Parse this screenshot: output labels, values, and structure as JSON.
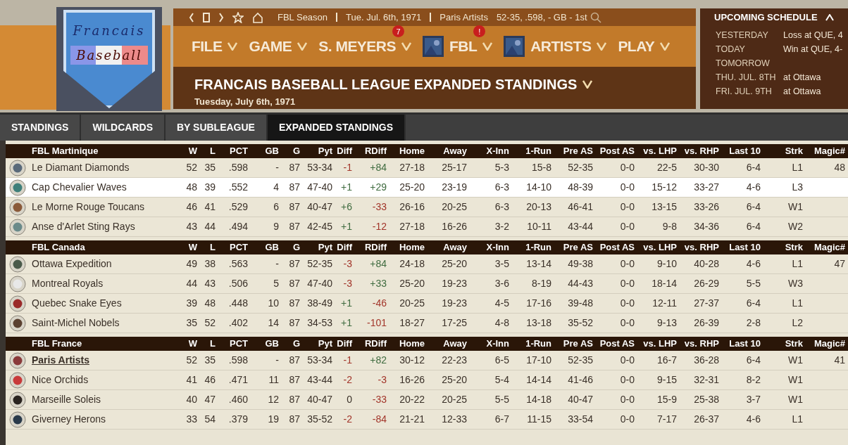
{
  "logo": {
    "top": "Francais",
    "bottom": "Baseball"
  },
  "info_bar": {
    "season": "FBL Season",
    "date": "Tue. Jul. 6th, 1971",
    "team": "Paris Artists",
    "record": "52-35, .598, - GB - 1st"
  },
  "menu": [
    {
      "label": "FILE"
    },
    {
      "label": "GAME"
    },
    {
      "label": "S. MEYERS",
      "badge": "7"
    },
    {
      "label": "FBL",
      "badge": "!",
      "thumbnail": true
    },
    {
      "label": "ARTISTS",
      "thumbnail": true
    },
    {
      "label": "PLAY"
    }
  ],
  "page_title": "FRANCAIS BASEBALL LEAGUE EXPANDED STANDINGS",
  "page_subtitle": "Tuesday, July 6th, 1971",
  "schedule": {
    "title": "UPCOMING SCHEDULE",
    "items": [
      {
        "day": "YESTERDAY",
        "result": "Loss at QUE, 4"
      },
      {
        "day": "TODAY",
        "result": "Win at QUE, 4-"
      },
      {
        "day": "TOMORROW"
      },
      {
        "day": "THU. JUL. 8TH",
        "result": "at Ottawa"
      },
      {
        "day": "FRI. JUL. 9TH",
        "result": "at Ottawa"
      }
    ]
  },
  "tabs": [
    {
      "label": "STANDINGS",
      "selected": false
    },
    {
      "label": "WILDCARDS",
      "selected": false
    },
    {
      "label": "BY SUBLEAGUE",
      "selected": false
    },
    {
      "label": "EXPANDED STANDINGS",
      "selected": true
    }
  ],
  "groups": [
    {
      "name": "FBL Martinique",
      "columns": [
        "W",
        "L",
        "PCT",
        "GB",
        "G",
        "Pyt",
        "Diff",
        "RDiff",
        "Home",
        "Away",
        "X-Inn",
        "1-Run",
        "Pre AS",
        "Post AS",
        "vs. LHP",
        "vs. RHP",
        "Last 10",
        "Strk",
        "Magic#"
      ],
      "rows": [
        {
          "team": "Le Diamant Diamonds",
          "selected": false,
          "own_team": false,
          "stats": [
            "52",
            "35",
            ".598",
            "-",
            "87",
            "53-34"
          ],
          "diff": {
            "text": "-1",
            "color": "#a2352a"
          },
          "rdiff": {
            "text": "+84",
            "color": "#3f6b3f"
          },
          "stats_2": [
            "27-18",
            "25-17",
            "5-3",
            "15-8",
            "52-35",
            "0-0",
            "22-5",
            "30-30",
            "6-4",
            "L1"
          ],
          "magic": "48"
        },
        {
          "team": "Cap Chevalier Waves",
          "selected": true,
          "own_team": false,
          "stats": [
            "48",
            "39",
            ".552",
            "4",
            "87",
            "47-40"
          ],
          "diff": {
            "text": "+1",
            "color": "#3f6b3f"
          },
          "rdiff": {
            "text": "+29",
            "color": "#3f6b3f"
          },
          "stats_2": [
            "25-20",
            "23-19",
            "6-3",
            "14-10",
            "48-39",
            "0-0",
            "15-12",
            "33-27",
            "4-6",
            "L3"
          ]
        },
        {
          "team": "Le Morne Rouge Toucans",
          "selected": false,
          "own_team": false,
          "stats": [
            "46",
            "41",
            ".529",
            "6",
            "87",
            "40-47"
          ],
          "diff": {
            "text": "+6",
            "color": "#3f6b3f"
          },
          "rdiff": {
            "text": "-33",
            "color": "#a2352a"
          },
          "stats_2": [
            "26-16",
            "20-25",
            "6-3",
            "20-13",
            "46-41",
            "0-0",
            "13-15",
            "33-26",
            "6-4",
            "W1"
          ]
        },
        {
          "team": "Anse d'Arlet Sting Rays",
          "selected": false,
          "own_team": false,
          "stats": [
            "43",
            "44",
            ".494",
            "9",
            "87",
            "42-45"
          ],
          "diff": {
            "text": "+1",
            "color": "#3f6b3f"
          },
          "rdiff": {
            "text": "-12",
            "color": "#a2352a"
          },
          "stats_2": [
            "27-18",
            "16-26",
            "3-2",
            "10-11",
            "43-44",
            "0-0",
            "9-8",
            "34-36",
            "6-4",
            "W2"
          ]
        }
      ]
    },
    {
      "name": "FBL Canada",
      "columns": [
        "W",
        "L",
        "PCT",
        "GB",
        "G",
        "Pyt",
        "Diff",
        "RDiff",
        "Home",
        "Away",
        "X-Inn",
        "1-Run",
        "Pre AS",
        "Post AS",
        "vs. LHP",
        "vs. RHP",
        "Last 10",
        "Strk",
        "Magic#"
      ],
      "rows": [
        {
          "team": "Ottawa Expedition",
          "selected": false,
          "own_team": false,
          "stats": [
            "49",
            "38",
            ".563",
            "-",
            "87",
            "52-35"
          ],
          "diff": {
            "text": "-3",
            "color": "#a2352a"
          },
          "rdiff": {
            "text": "+84",
            "color": "#3f6b3f"
          },
          "stats_2": [
            "24-18",
            "25-20",
            "3-5",
            "13-14",
            "49-38",
            "0-0",
            "9-10",
            "40-28",
            "4-6",
            "L1"
          ],
          "magic": "47"
        },
        {
          "team": "Montreal Royals",
          "selected": false,
          "own_team": false,
          "stats": [
            "44",
            "43",
            ".506",
            "5",
            "87",
            "47-40"
          ],
          "diff": {
            "text": "-3",
            "color": "#a2352a"
          },
          "rdiff": {
            "text": "+33",
            "color": "#3f6b3f"
          },
          "stats_2": [
            "25-20",
            "19-23",
            "3-6",
            "8-19",
            "44-43",
            "0-0",
            "18-14",
            "26-29",
            "5-5",
            "W3"
          ]
        },
        {
          "team": "Quebec Snake Eyes",
          "selected": false,
          "own_team": false,
          "stats": [
            "39",
            "48",
            ".448",
            "10",
            "87",
            "38-49"
          ],
          "diff": {
            "text": "+1",
            "color": "#3f6b3f"
          },
          "rdiff": {
            "text": "-46",
            "color": "#a2352a"
          },
          "stats_2": [
            "20-25",
            "19-23",
            "4-5",
            "17-16",
            "39-48",
            "0-0",
            "12-11",
            "27-37",
            "6-4",
            "L1"
          ]
        },
        {
          "team": "Saint-Michel Nobels",
          "selected": false,
          "own_team": false,
          "stats": [
            "35",
            "52",
            ".402",
            "14",
            "87",
            "34-53"
          ],
          "diff": {
            "text": "+1",
            "color": "#3f6b3f"
          },
          "rdiff": {
            "text": "-101",
            "color": "#a2352a"
          },
          "stats_2": [
            "18-27",
            "17-25",
            "4-8",
            "13-18",
            "35-52",
            "0-0",
            "9-13",
            "26-39",
            "2-8",
            "L2"
          ]
        }
      ]
    },
    {
      "name": "FBL France",
      "columns": [
        "W",
        "L",
        "PCT",
        "GB",
        "G",
        "Pyt",
        "Diff",
        "RDiff",
        "Home",
        "Away",
        "X-Inn",
        "1-Run",
        "Pre AS",
        "Post AS",
        "vs. LHP",
        "vs. RHP",
        "Last 10",
        "Strk",
        "Magic#"
      ],
      "rows": [
        {
          "team": "Paris Artists",
          "selected": false,
          "own_team": true,
          "stats": [
            "52",
            "35",
            ".598",
            "-",
            "87",
            "53-34"
          ],
          "diff": {
            "text": "-1",
            "color": "#a2352a"
          },
          "rdiff": {
            "text": "+82",
            "color": "#3f6b3f"
          },
          "stats_2": [
            "30-12",
            "22-23",
            "6-5",
            "17-10",
            "52-35",
            "0-0",
            "16-7",
            "36-28",
            "6-4",
            "W1"
          ],
          "magic": "41"
        },
        {
          "team": "Nice Orchids",
          "selected": false,
          "own_team": false,
          "stats": [
            "41",
            "46",
            ".471",
            "11",
            "87",
            "43-44"
          ],
          "diff": {
            "text": "-2",
            "color": "#a2352a"
          },
          "rdiff": {
            "text": "-3",
            "color": "#a2352a"
          },
          "stats_2": [
            "16-26",
            "25-20",
            "5-4",
            "14-14",
            "41-46",
            "0-0",
            "9-15",
            "32-31",
            "8-2",
            "W1"
          ]
        },
        {
          "team": "Marseille Soleis",
          "selected": false,
          "own_team": false,
          "stats": [
            "40",
            "47",
            ".460",
            "12",
            "87",
            "40-47"
          ],
          "diff": {
            "text": "0",
            "color": "#3a3028"
          },
          "rdiff": {
            "text": "-33",
            "color": "#a2352a"
          },
          "stats_2": [
            "20-22",
            "20-25",
            "5-5",
            "14-18",
            "40-47",
            "0-0",
            "15-9",
            "25-38",
            "3-7",
            "W1"
          ]
        },
        {
          "team": "Giverney Herons",
          "selected": false,
          "own_team": false,
          "stats": [
            "33",
            "54",
            ".379",
            "19",
            "87",
            "35-52"
          ],
          "diff": {
            "text": "-2",
            "color": "#a2352a"
          },
          "rdiff": {
            "text": "-84",
            "color": "#a2352a"
          },
          "stats_2": [
            "21-21",
            "12-33",
            "6-7",
            "11-15",
            "33-54",
            "0-0",
            "7-17",
            "26-37",
            "4-6",
            "L1"
          ]
        }
      ]
    }
  ]
}
